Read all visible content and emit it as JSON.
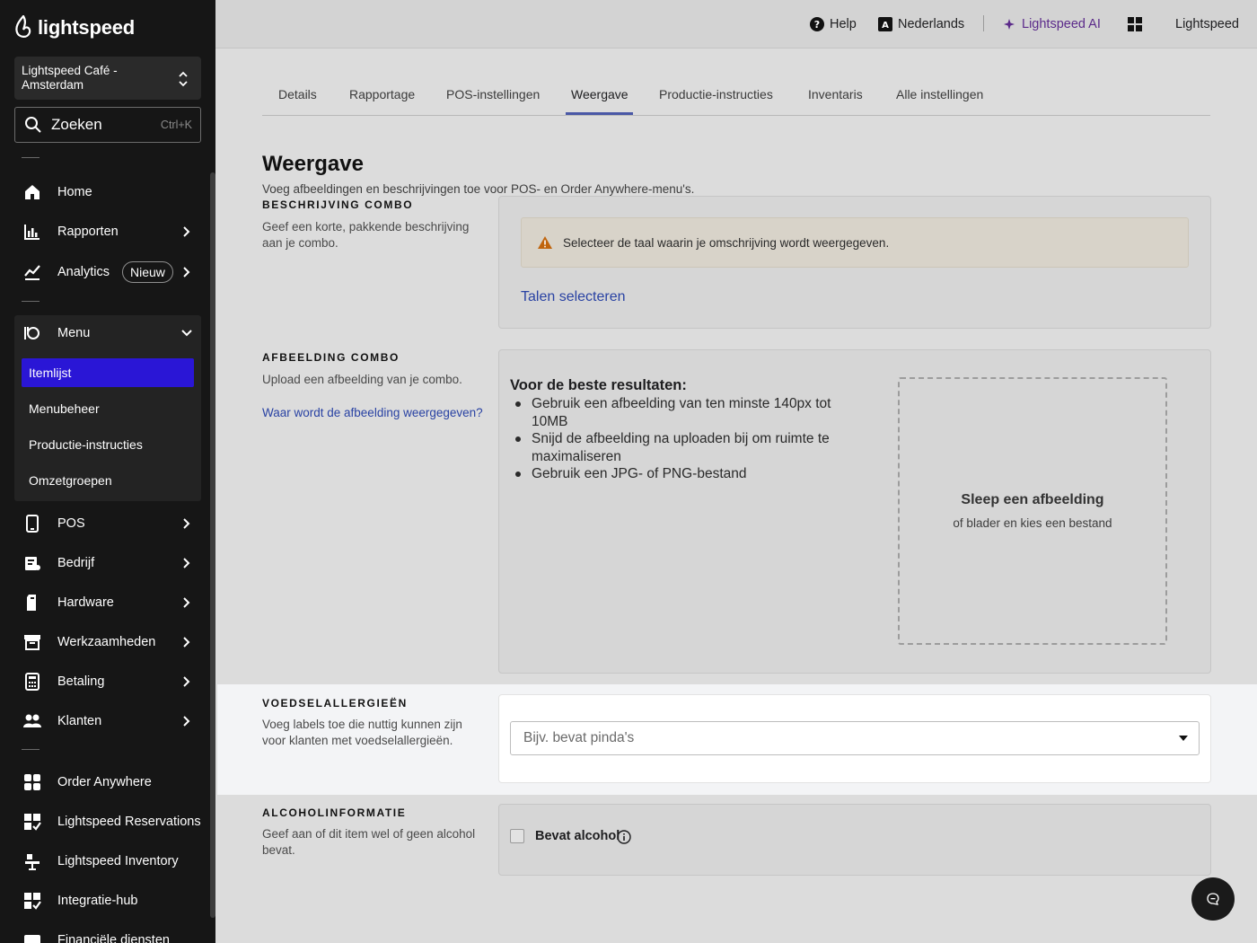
{
  "brand": {
    "logo_text": "lightspeed"
  },
  "sidebar": {
    "store_name": "Lightspeed Café - Amsterdam",
    "search": {
      "label": "Zoeken",
      "shortcut": "Ctrl+K"
    },
    "items": [
      {
        "label": "Home",
        "icon": "home-icon"
      },
      {
        "label": "Rapporten",
        "icon": "bar-chart-icon"
      },
      {
        "label": "Analytics",
        "icon": "trend-icon",
        "badge": "Nieuw"
      },
      {
        "label": "Menu",
        "icon": "menu-icon"
      },
      {
        "label": "POS",
        "icon": "tablet-icon"
      },
      {
        "label": "Bedrijf",
        "icon": "business-icon"
      },
      {
        "label": "Hardware",
        "icon": "hardware-icon"
      },
      {
        "label": "Werkzaamheden",
        "icon": "archive-icon"
      },
      {
        "label": "Betaling",
        "icon": "payment-icon"
      },
      {
        "label": "Klanten",
        "icon": "customers-icon"
      },
      {
        "label": "Order Anywhere",
        "icon": "order-anywhere-icon"
      },
      {
        "label": "Lightspeed Reservations",
        "icon": "reservations-icon"
      },
      {
        "label": "Lightspeed Inventory",
        "icon": "inventory-icon"
      },
      {
        "label": "Integratie-hub",
        "icon": "integrations-icon"
      },
      {
        "label": "Financiële diensten",
        "icon": "wallet-icon"
      }
    ],
    "menu_subitems": [
      "Itemlijst",
      "Menubeheer",
      "Productie-instructies",
      "Omzetgroepen"
    ]
  },
  "topbar": {
    "help": "Help",
    "language": "Nederlands",
    "ai": "Lightspeed AI",
    "account": "Lightspeed"
  },
  "tabs": [
    "Details",
    "Rapportage",
    "POS-instellingen",
    "Weergave",
    "Productie-instructies",
    "Inventaris",
    "Alle instellingen"
  ],
  "active_tab": "Weergave",
  "page": {
    "title": "Weergave",
    "subtitle": "Voeg afbeeldingen en beschrijvingen toe voor POS- en Order Anywhere-menu's."
  },
  "description_section": {
    "heading": "BESCHRIJVING COMBO",
    "desc": "Geef een korte, pakkende beschrijving aan je combo.",
    "warning": "Selecteer de taal waarin je omschrijving wordt weergegeven.",
    "link": "Talen selecteren"
  },
  "image_section": {
    "heading": "AFBEELDING COMBO",
    "desc": "Upload een afbeelding van je combo.",
    "link": "Waar wordt de afbeelding weergegeven?",
    "tips_title": "Voor de beste resultaten:",
    "tips": [
      "Gebruik een afbeelding van ten minste 140px tot 10MB",
      "Snijd de afbeelding na uploaden bij om ruimte te maximaliseren",
      "Gebruik een JPG- of PNG-bestand"
    ],
    "drop_title": "Sleep een afbeelding",
    "drop_sub": "of blader en kies een bestand"
  },
  "allergy_section": {
    "heading": "VOEDSELALLERGIEËN",
    "desc": "Voeg labels toe die nuttig kunnen zijn voor klanten met voedselallergieën.",
    "placeholder": "Bijv. bevat pinda's"
  },
  "alcohol_section": {
    "heading": "ALCOHOLINFORMATIE",
    "desc": "Geef aan of dit item wel of geen alcohol bevat.",
    "checkbox_label": "Bevat alcohol",
    "checked": false
  },
  "colors": {
    "accent": "#2a16d6",
    "link": "#2942a3",
    "ai": "#5b2a8a",
    "warning": "#c0650e"
  }
}
